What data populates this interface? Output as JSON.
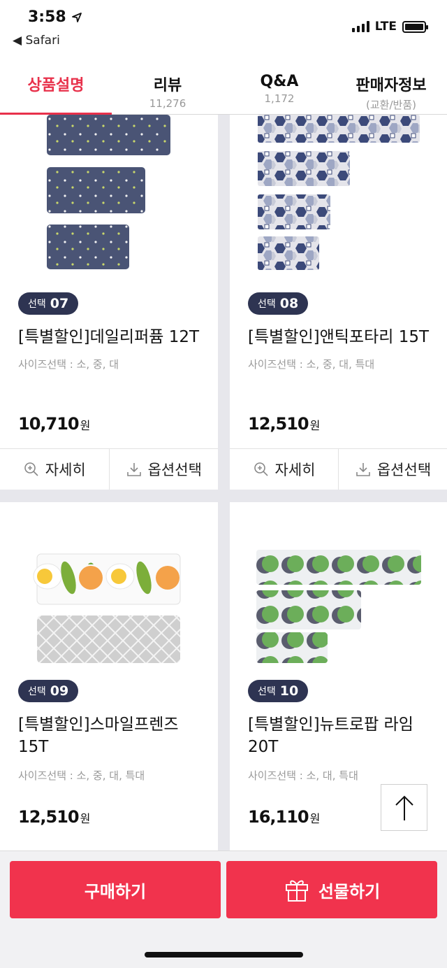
{
  "status": {
    "time": "3:58",
    "back": "Safari",
    "network": "LTE"
  },
  "tabs": [
    {
      "label": "상품설명",
      "sub": ""
    },
    {
      "label": "리뷰",
      "sub": "11,276"
    },
    {
      "label": "Q&A",
      "sub": "1,172"
    },
    {
      "label": "판매자정보",
      "sub": "(교환/반품)"
    }
  ],
  "products": [
    {
      "badge_prefix": "선택",
      "badge_num": "07",
      "name": "[특별할인]데일리퍼퓸 12T",
      "options": "사이즈선택 : 소, 중, 대",
      "price": "10,710",
      "unit": "원"
    },
    {
      "badge_prefix": "선택",
      "badge_num": "08",
      "name": "[특별할인]앤틱포타리 15T",
      "options": "사이즈선택 : 소, 중, 대, 특대",
      "price": "12,510",
      "unit": "원"
    },
    {
      "badge_prefix": "선택",
      "badge_num": "09",
      "name": "[특별할인]스마일프렌즈 15T",
      "options": "사이즈선택 : 소, 중, 대, 특대",
      "price": "12,510",
      "unit": "원"
    },
    {
      "badge_prefix": "선택",
      "badge_num": "10",
      "name": "[특별할인]뉴트로팝 라임 20T",
      "options": "사이즈선택 : 소, 대, 특대",
      "price": "16,110",
      "unit": "원"
    }
  ],
  "actions": {
    "detail": "자세히",
    "option": "옵션선택"
  },
  "bottom": {
    "buy": "구매하기",
    "gift": "선물하기"
  },
  "icons": [
    "location-arrow-icon",
    "signal-icon",
    "battery-icon",
    "magnifier-plus-icon",
    "download-icon",
    "arrow-up-icon",
    "gift-icon"
  ],
  "colors": {
    "accent": "#e8314b",
    "button": "#f1334d",
    "badge": "#2e3452"
  }
}
